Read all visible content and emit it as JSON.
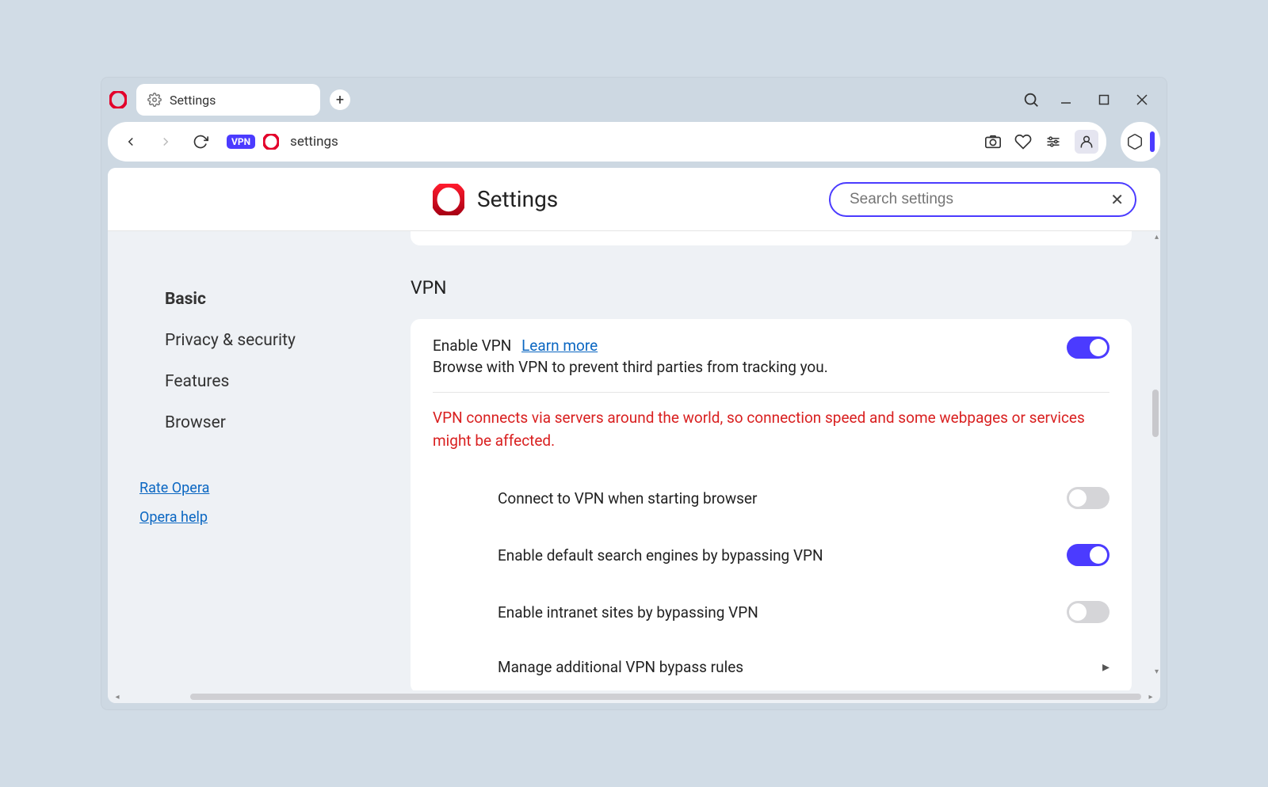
{
  "tab": {
    "title": "Settings"
  },
  "url": "settings",
  "vpn_badge": "VPN",
  "header": {
    "title": "Settings",
    "search_placeholder": "Search settings"
  },
  "sidebar": {
    "items": [
      {
        "label": "Basic",
        "active": true
      },
      {
        "label": "Privacy & security"
      },
      {
        "label": "Features"
      },
      {
        "label": "Browser"
      }
    ],
    "links": [
      {
        "label": "Rate Opera"
      },
      {
        "label": "Opera help"
      }
    ]
  },
  "section": {
    "title": "VPN",
    "enable_label": "Enable VPN",
    "learn_more": "Learn more",
    "enable_desc": "Browse with VPN to prevent third parties from tracking you.",
    "warning": "VPN connects via servers around the world, so connection speed and some webpages or services might be affected.",
    "sub": [
      {
        "label": "Connect to VPN when starting browser",
        "on": false
      },
      {
        "label": "Enable default search engines by bypassing VPN",
        "on": true
      },
      {
        "label": "Enable intranet sites by bypassing VPN",
        "on": false
      }
    ],
    "manage_label": "Manage additional VPN bypass rules"
  }
}
